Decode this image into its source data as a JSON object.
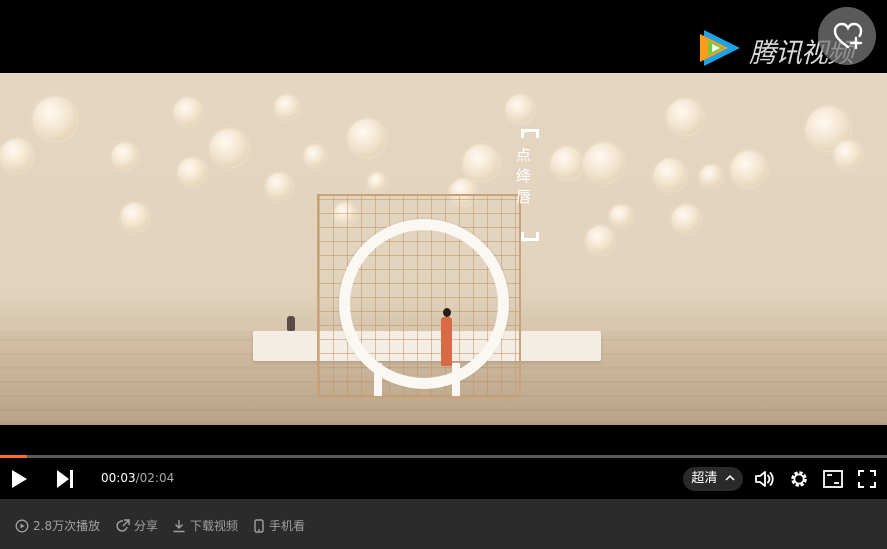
{
  "video": {
    "overlay_title": "点绛唇",
    "watermark": "腾讯视频"
  },
  "icons": {
    "favorite": "heart-plus-icon",
    "play": "play-icon",
    "next": "next-icon",
    "volume": "volume-icon",
    "settings": "gear-icon",
    "pip": "picture-in-picture-icon",
    "fullscreen": "fullscreen-icon",
    "views": "play-circle-icon",
    "share": "share-icon",
    "download": "download-icon",
    "mobile": "phone-icon"
  },
  "player": {
    "progress": 0.03,
    "current_time": "00:03",
    "separator": "/",
    "duration": "02:04",
    "quality_label": "超清",
    "accent_color": "#ff6e1e"
  },
  "meta": {
    "views": "2.8万次播放",
    "share_label": "分享",
    "download_label": "下载视频",
    "mobile_label": "手机看"
  }
}
